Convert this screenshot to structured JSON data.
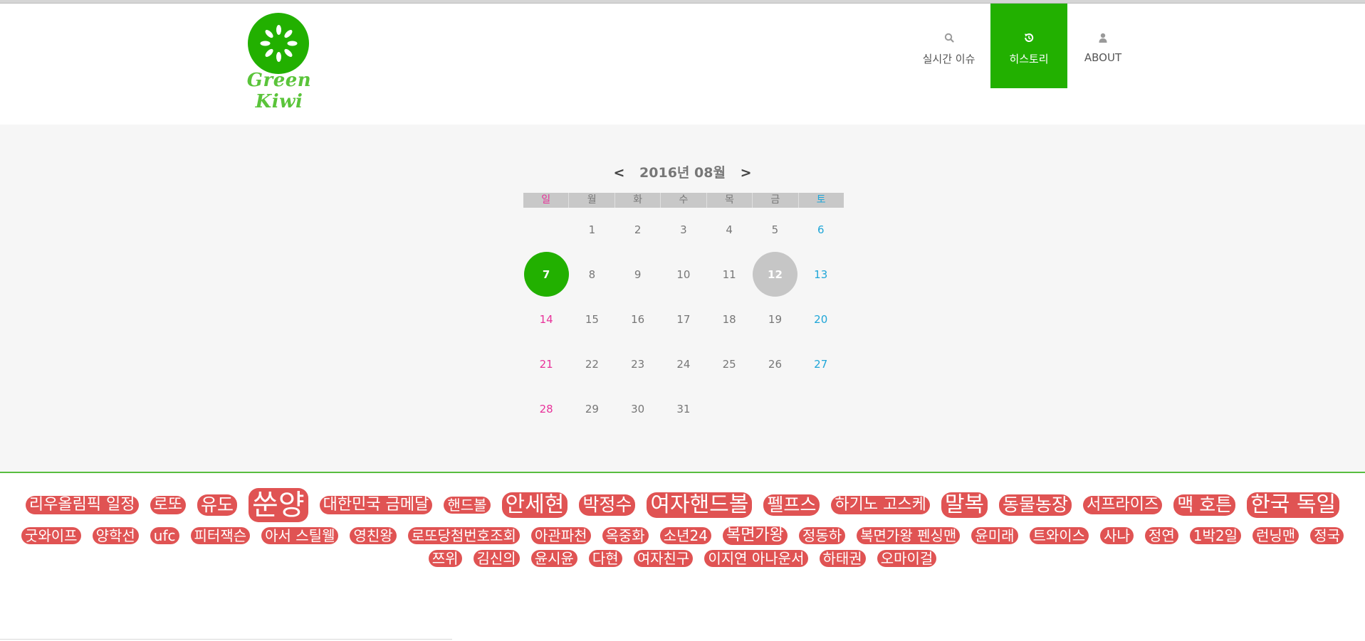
{
  "header": {
    "logo_text": "Green Kiwi",
    "nav": [
      {
        "label": "실시간 이슈",
        "icon": "search-icon"
      },
      {
        "label": "히스토리",
        "icon": "history-icon"
      },
      {
        "label": "ABOUT",
        "icon": "user-icon"
      }
    ],
    "colors": {
      "accent": "#22b000",
      "tag": "#e05353"
    }
  },
  "calendar": {
    "prev": "<",
    "next": ">",
    "title": "2016년 08월",
    "weekdays": [
      "일",
      "월",
      "화",
      "수",
      "목",
      "금",
      "토"
    ],
    "weeks": [
      [
        "",
        "1",
        "2",
        "3",
        "4",
        "5",
        "6"
      ],
      [
        "7",
        "8",
        "9",
        "10",
        "11",
        "12",
        "13"
      ],
      [
        "14",
        "15",
        "16",
        "17",
        "18",
        "19",
        "20"
      ],
      [
        "21",
        "22",
        "23",
        "24",
        "25",
        "26",
        "27"
      ],
      [
        "28",
        "29",
        "30",
        "31",
        "",
        "",
        ""
      ]
    ],
    "today": "7",
    "selected": "12"
  },
  "tags": [
    {
      "text": "리우올림픽 일정",
      "size": "m"
    },
    {
      "text": "로또",
      "size": "m"
    },
    {
      "text": "유도",
      "size": "l"
    },
    {
      "text": "쑨양",
      "size": "xxl"
    },
    {
      "text": "대한민국 금메달",
      "size": "m"
    },
    {
      "text": "핸드볼",
      "size": "s"
    },
    {
      "text": "안세현",
      "size": "xl"
    },
    {
      "text": "박정수",
      "size": "l"
    },
    {
      "text": "여자핸드볼",
      "size": "xl"
    },
    {
      "text": "펠프스",
      "size": "l"
    },
    {
      "text": "하기노 고스케",
      "size": "m"
    },
    {
      "text": "말복",
      "size": "xl"
    },
    {
      "text": "동물농장",
      "size": "l"
    },
    {
      "text": "서프라이즈",
      "size": "m"
    },
    {
      "text": "맥 호튼",
      "size": "l"
    },
    {
      "text": "한국 독일",
      "size": "xl"
    },
    {
      "text": "굿와이프",
      "size": "s"
    },
    {
      "text": "양학선",
      "size": "s"
    },
    {
      "text": "ufc",
      "size": "s"
    },
    {
      "text": "피터잭슨",
      "size": "s"
    },
    {
      "text": "아서 스틸웰",
      "size": "s"
    },
    {
      "text": "영친왕",
      "size": "s"
    },
    {
      "text": "로또당첨번호조회",
      "size": "s"
    },
    {
      "text": "아관파천",
      "size": "s"
    },
    {
      "text": "옥중화",
      "size": "s"
    },
    {
      "text": "소년24",
      "size": "s"
    },
    {
      "text": "복면가왕",
      "size": "m"
    },
    {
      "text": "정동하",
      "size": "s"
    },
    {
      "text": "복면가왕 펜싱맨",
      "size": "s"
    },
    {
      "text": "윤미래",
      "size": "s"
    },
    {
      "text": "트와이스",
      "size": "s"
    },
    {
      "text": "사나",
      "size": "s"
    },
    {
      "text": "정연",
      "size": "s"
    },
    {
      "text": "1박2일",
      "size": "s"
    },
    {
      "text": "런닝맨",
      "size": "s"
    },
    {
      "text": "정국",
      "size": "s"
    },
    {
      "text": "쯔위",
      "size": "s"
    },
    {
      "text": "김신의",
      "size": "s"
    },
    {
      "text": "윤시윤",
      "size": "s"
    },
    {
      "text": "다현",
      "size": "s"
    },
    {
      "text": "여자친구",
      "size": "s"
    },
    {
      "text": "이지연 아나운서",
      "size": "s"
    },
    {
      "text": "하태권",
      "size": "s"
    },
    {
      "text": "오마이걸",
      "size": "s"
    }
  ]
}
